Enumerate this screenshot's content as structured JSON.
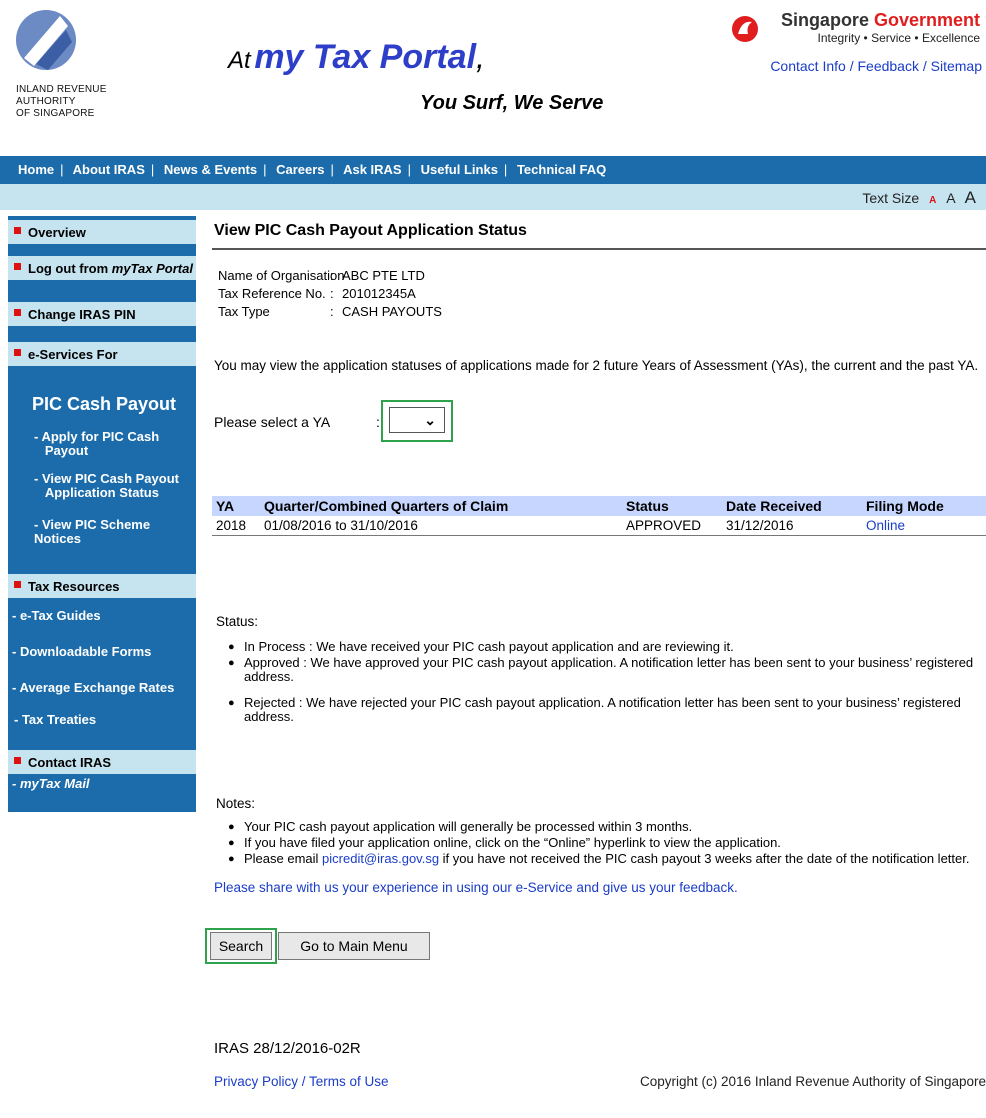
{
  "header": {
    "org_lines": [
      "INLAND REVENUE",
      "AUTHORITY",
      "OF SINGAPORE"
    ],
    "tagline_at": "At",
    "tagline_portal": "my Tax Portal",
    "tagline_comma": ",",
    "slogan": "You Surf, We Serve",
    "gov_title_a": "Singapore",
    "gov_title_b": "Government",
    "gov_motto": "Integrity • Service • Excellence",
    "links": {
      "contact": "Contact Info /",
      "feedback": "Feedback /",
      "sitemap": "Sitemap"
    }
  },
  "nav": {
    "items": [
      "Home",
      "About IRAS",
      "News & Events",
      "Careers",
      "Ask IRAS",
      "Useful Links",
      "Technical FAQ"
    ],
    "text_size_label": "Text Size",
    "size_small": "A",
    "size_medium": "A",
    "size_large": "A"
  },
  "sidebar": {
    "overview": "Overview",
    "logout_prefix": "Log out from ",
    "logout_italic": "myTax Portal",
    "change_pin": "Change IRAS PIN",
    "eservices": "e-Services For",
    "pic_title": "PIC Cash Payout",
    "pic_links": [
      "- Apply for PIC Cash\n   Payout",
      "- View PIC Cash Payout\n   Application Status",
      "- View PIC Scheme Notices"
    ],
    "tax_resources": "Tax Resources",
    "resource_links": [
      "- e-Tax Guides",
      "- Downloadable Forms",
      "- Average Exchange Rates",
      "- Tax Treaties"
    ],
    "contact_iras": "Contact IRAS",
    "mytax_mail": "- myTax Mail"
  },
  "main": {
    "title": "View PIC Cash Payout Application Status",
    "info": [
      {
        "label": "Name of Organisation",
        "value": "ABC PTE LTD"
      },
      {
        "label": "Tax Reference No.",
        "value": "201012345A"
      },
      {
        "label": "Tax Type",
        "value": "CASH PAYOUTS"
      }
    ],
    "intro": "You may view the application statuses of applications made for 2 future Years of Assessment (YAs), the current and the past YA.",
    "ya_label": "Please select a YA",
    "ya_colon": ":",
    "ya_selected": "",
    "table": {
      "headers": [
        "YA",
        "Quarter/Combined Quarters of Claim",
        "Status",
        "Date Received",
        "Filing Mode"
      ],
      "rows": [
        [
          "2018",
          "01/08/2016 to 31/10/2016",
          "APPROVED",
          "31/12/2016",
          "Online"
        ]
      ]
    },
    "status_heading": "Status:",
    "status_items": [
      "In Process : We have received your PIC cash payout application and are reviewing it.",
      "Approved   : We have approved your PIC cash payout application. A notification letter has been sent to your business’ registered address.",
      "Rejected   : We have rejected your PIC cash payout application. A notification letter has been sent to your business’ registered address."
    ],
    "notes_heading": "Notes:",
    "notes_items": [
      "Your PIC cash payout application will generally be processed within 3 months.",
      "If you have filed your application online, click on the “Online” hyperlink to view the application."
    ],
    "note3_prefix": "Please email ",
    "note3_email": "picredit@iras.gov.sg",
    "note3_suffix": " if you have not received the PIC cash payout 3 weeks after the date of the notification letter.",
    "feedback": "Please share with us your experience in using our e-Service and give us your feedback.",
    "search_button": "Search",
    "main_menu_button": "Go to Main Menu"
  },
  "footer": {
    "code": "IRAS 28/12/2016-02R",
    "privacy": "Privacy Policy",
    "slash": " / ",
    "terms": "Terms of Use",
    "copyright": "Copyright (c) 2016 Inland Revenue Authority of Singapore"
  }
}
